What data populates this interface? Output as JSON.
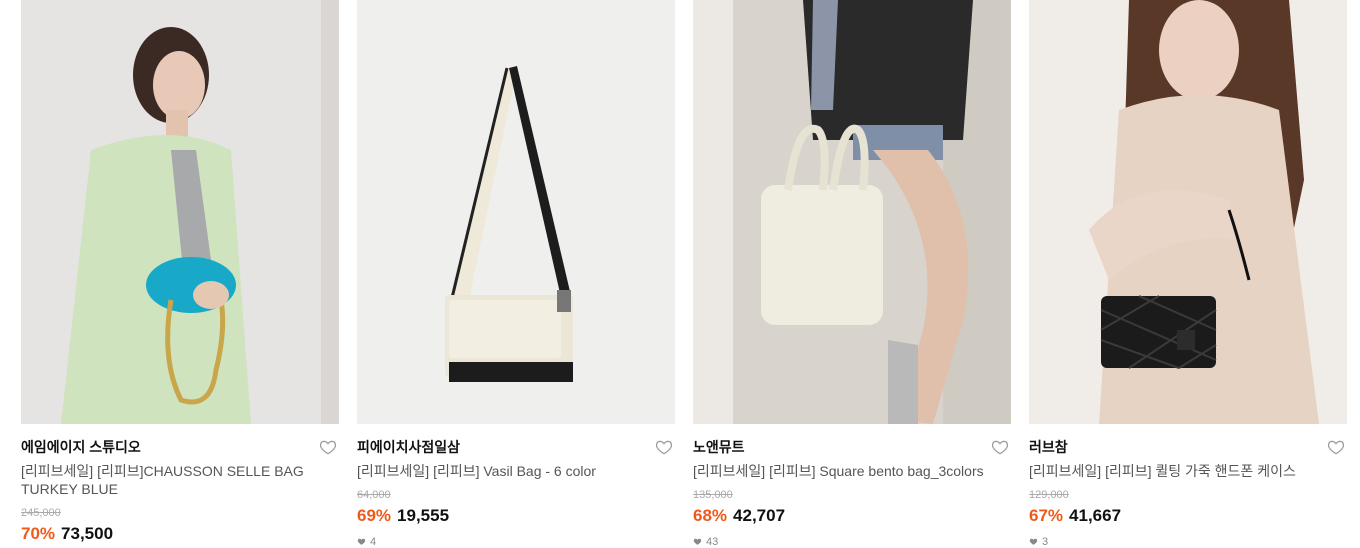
{
  "products": [
    {
      "brand": "에임에이지 스튜디오",
      "title": "[리피브세일] [리피브]CHAUSSON SELLE BAG TURKEY BLUE",
      "original_price": "245,000",
      "discount": "70%",
      "price": "73,500",
      "likes": ""
    },
    {
      "brand": "피에이치사점일삼",
      "title": "[리피브세일] [리피브] Vasil Bag - 6 color",
      "original_price": "64,000",
      "discount": "69%",
      "price": "19,555",
      "likes": "4"
    },
    {
      "brand": "노앤뮤트",
      "title": "[리피브세일] [리피브] Square bento bag_3colors",
      "original_price": "135,000",
      "discount": "68%",
      "price": "42,707",
      "likes": "43"
    },
    {
      "brand": "러브참",
      "title": "[리피브세일] [리피브] 퀼팅 가죽 핸드폰 케이스",
      "original_price": "129,000",
      "discount": "67%",
      "price": "41,667",
      "likes": "3"
    }
  ],
  "icons": {
    "wishlist": "heart-outline-icon",
    "likes": "heart-filled-icon"
  },
  "colors": {
    "discount": "#f05a1a",
    "brand_text": "#111111",
    "title_text": "#555555"
  }
}
